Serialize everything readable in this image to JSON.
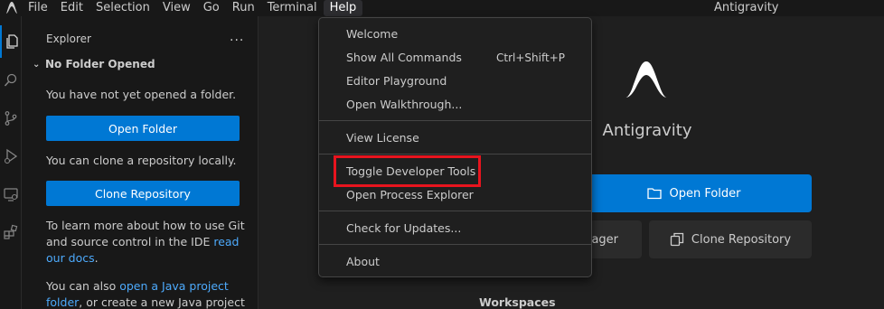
{
  "titlebar": {
    "app_title": "Antigravity",
    "menus": [
      "File",
      "Edit",
      "Selection",
      "View",
      "Go",
      "Run",
      "Terminal",
      "Help"
    ]
  },
  "activity_bar": {
    "icons": [
      "files-icon",
      "search-icon",
      "source-control-icon",
      "run-debug-icon",
      "remote-explorer-icon",
      "extensions-icon"
    ]
  },
  "sidebar": {
    "title": "Explorer",
    "more_label": "...",
    "section_title": "No Folder Opened",
    "not_opened_text": "You have not yet opened a folder.",
    "open_folder_label": "Open Folder",
    "clone_text": "You can clone a repository locally.",
    "clone_label": "Clone Repository",
    "git_text_1": "To learn more about how to use Git",
    "git_text_2": "and source control in the IDE ",
    "git_link_1": "read",
    "git_link_2": "our docs",
    "git_text_end": ".",
    "java_text_1": "You can also ",
    "java_link_1": "open a Java project",
    "java_link_2": "folder",
    "java_text_2": ", or create a new Java project"
  },
  "main": {
    "title": "Antigravity",
    "open_folder_label": "Open Folder",
    "manager_label": "ager",
    "clone_label": "Clone Repository",
    "workspaces_label": "Workspaces"
  },
  "help_menu": {
    "items": [
      {
        "label": "Welcome",
        "shortcut": ""
      },
      {
        "label": "Show All Commands",
        "shortcut": "Ctrl+Shift+P"
      },
      {
        "label": "Editor Playground",
        "shortcut": ""
      },
      {
        "label": "Open Walkthrough...",
        "shortcut": ""
      },
      {
        "label": "View License",
        "shortcut": ""
      },
      {
        "label": "Toggle Developer Tools",
        "shortcut": ""
      },
      {
        "label": "Open Process Explorer",
        "shortcut": ""
      },
      {
        "label": "Check for Updates...",
        "shortcut": ""
      },
      {
        "label": "About",
        "shortcut": ""
      }
    ],
    "highlighted_item": "Toggle Developer Tools"
  },
  "colors": {
    "accent": "#0078d4",
    "highlight_border": "#e8141e",
    "link": "#4daafc"
  }
}
